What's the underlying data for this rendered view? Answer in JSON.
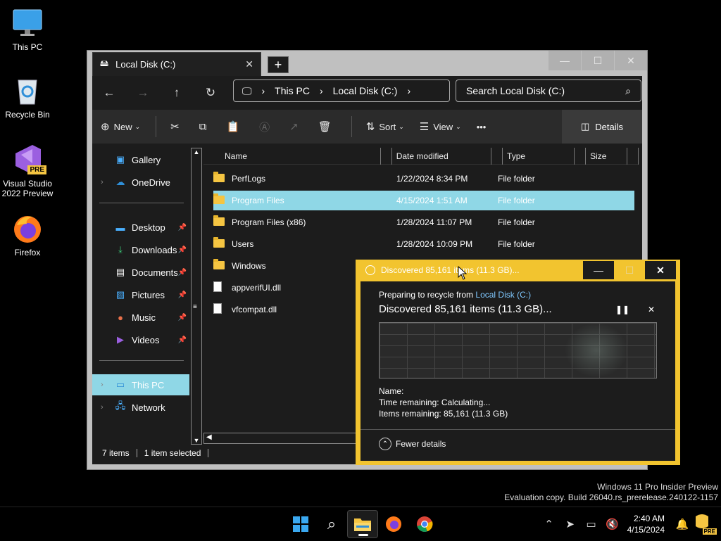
{
  "desktop": {
    "icons": [
      {
        "label": "This PC"
      },
      {
        "label": "Recycle Bin"
      },
      {
        "label": "Visual Studio 2022 Preview",
        "badge": "PRE"
      },
      {
        "label": "Firefox"
      }
    ]
  },
  "explorer": {
    "tab_title": "Local Disk (C:)",
    "tab_close": "✕",
    "new_tab": "+",
    "window_buttons": {
      "minimize": "—",
      "maximize": "☐",
      "close": "✕"
    },
    "nav": {
      "back": "←",
      "forward": "→",
      "up": "↑",
      "refresh": "↻"
    },
    "address": {
      "crumbs": [
        "This PC",
        "Local Disk (C:)"
      ],
      "sep": "›"
    },
    "search_placeholder": "Search Local Disk (C:)",
    "commands": {
      "new": "New",
      "sort": "Sort",
      "view": "View",
      "more": "•••",
      "details": "Details"
    },
    "sidebar": {
      "items": [
        {
          "label": "Gallery"
        },
        {
          "label": "OneDrive"
        },
        {
          "label": "Desktop"
        },
        {
          "label": "Downloads"
        },
        {
          "label": "Documents"
        },
        {
          "label": "Pictures"
        },
        {
          "label": "Music"
        },
        {
          "label": "Videos"
        },
        {
          "label": "This PC"
        },
        {
          "label": "Network"
        }
      ]
    },
    "columns": {
      "name": "Name",
      "date": "Date modified",
      "type": "Type",
      "size": "Size"
    },
    "files": [
      {
        "name": "PerfLogs",
        "date": "1/22/2024 8:34 PM",
        "type": "File folder"
      },
      {
        "name": "Program Files",
        "date": "4/15/2024 1:51 AM",
        "type": "File folder"
      },
      {
        "name": "Program Files (x86)",
        "date": "1/28/2024 11:07 PM",
        "type": "File folder"
      },
      {
        "name": "Users",
        "date": "1/28/2024 10:09 PM",
        "type": "File folder"
      },
      {
        "name": "Windows",
        "date": "",
        "type": ""
      },
      {
        "name": "appverifUI.dll",
        "date": "",
        "type": ""
      },
      {
        "name": "vfcompat.dll",
        "date": "",
        "type": ""
      }
    ],
    "status": {
      "count": "7 items",
      "selected": "1 item selected"
    }
  },
  "dialog": {
    "title": "Discovered 85,161 items (11.3 GB)...",
    "preparing_prefix": "Preparing to recycle from",
    "preparing_link": "Local Disk (C:)",
    "discovered": "Discovered 85,161 items (11.3 GB)...",
    "pause": "❚❚",
    "cancel": "✕",
    "name_label": "Name:",
    "time_remaining": "Time remaining:  Calculating...",
    "items_remaining": "Items remaining:  85,161 (11.3 GB)",
    "fewer_details": "Fewer details"
  },
  "watermark": {
    "line1": "Windows 11 Pro Insider Preview",
    "line2": "Evaluation copy. Build 26040.rs_prerelease.240122-1157"
  },
  "taskbar": {
    "time": "2:40 AM",
    "date": "4/15/2024",
    "tray_badge": "PRE"
  }
}
